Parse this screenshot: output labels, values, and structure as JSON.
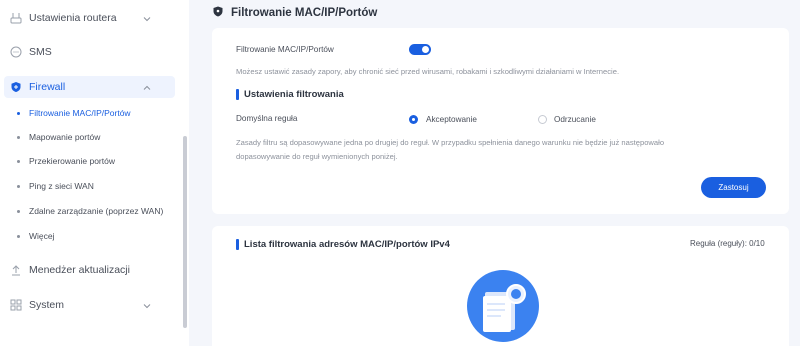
{
  "sidebar": {
    "items": [
      {
        "label": "Ustawienia routera",
        "icon": "router-settings-icon"
      },
      {
        "label": "SMS",
        "icon": "sms-icon"
      },
      {
        "label": "Firewall",
        "icon": "shield-icon"
      },
      {
        "label": "Menedżer aktualizacji",
        "icon": "upgrade-icon"
      },
      {
        "label": "System",
        "icon": "system-grid-icon"
      }
    ],
    "firewall_sub": [
      "Filtrowanie MAC/IP/Portów",
      "Mapowanie portów",
      "Przekierowanie portów",
      "Ping z sieci WAN",
      "Zdalne zarządzanie (poprzez WAN)",
      "Więcej"
    ]
  },
  "page": {
    "title": "Filtrowanie MAC/IP/Portów"
  },
  "filter_card": {
    "toggle_label": "Filtrowanie MAC/IP/Portów",
    "toggle_on": true,
    "description": "Możesz ustawić zasady zapory, aby chronić sieć przed wirusami, robakami i szkodliwymi działaniami w Internecie.",
    "section_title": "Ustawienia filtrowania",
    "default_rule_label": "Domyślna reguła",
    "option_accept": "Akceptowanie",
    "option_reject": "Odrzucanie",
    "selected": "Akceptowanie",
    "note_line1": "Zasady filtru są dopasowywane jedna po drugiej do reguł. W przypadku spełnienia danego warunku nie będzie już następowało",
    "note_line2": "dopasowywanie do reguł wymienionych poniżej.",
    "apply_button": "Zastosuj"
  },
  "list_card": {
    "title": "Lista filtrowania adresów MAC/IP/portów IPv4",
    "rule_count": "Reguła (reguły): 0/10"
  },
  "colors": {
    "accent": "#1a5fe0",
    "background": "#f4f6fb"
  }
}
